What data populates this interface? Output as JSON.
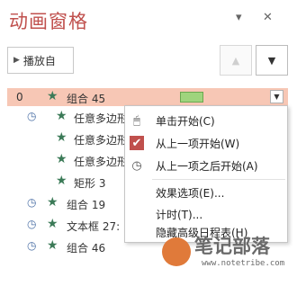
{
  "pane": {
    "title": "动画窗格",
    "dropdown_glyph": "▾",
    "close_glyph": "✕"
  },
  "toolbar": {
    "play_label": "播放自",
    "up_glyph": "▲",
    "down_glyph": "▼"
  },
  "rows": [
    {
      "num": "0",
      "clock": "",
      "name": "组合 45"
    },
    {
      "num": "",
      "clock": "◷",
      "name": "任意多边形"
    },
    {
      "num": "",
      "clock": "",
      "name": "任意多边形"
    },
    {
      "num": "",
      "clock": "",
      "name": "任意多边形"
    },
    {
      "num": "",
      "clock": "",
      "name": "矩形 3"
    },
    {
      "num": "",
      "clock": "◷",
      "name": "组合 19"
    },
    {
      "num": "",
      "clock": "◷",
      "name": "文本框 27:"
    },
    {
      "num": "",
      "clock": "◷",
      "name": "组合 46"
    }
  ],
  "menu": {
    "items": [
      {
        "label": "单击开始(C)",
        "icon": "🖱"
      },
      {
        "label": "从上一项开始(W)",
        "icon": "✔"
      },
      {
        "label": "从上一项之后开始(A)",
        "icon": "◷"
      },
      {
        "label": "效果选项(E)...",
        "icon": ""
      },
      {
        "label": "计时(T)...",
        "icon": ""
      },
      {
        "label": "隐藏高级日程表(H)",
        "icon": ""
      }
    ]
  },
  "watermark": {
    "title": "笔记部落",
    "url": "www.notetribe.com"
  },
  "colors": {
    "accent": "#c0504d",
    "selected_row": "#f7c7b5",
    "star": "#3b7a57",
    "timing_bar": "#9fd47d"
  }
}
